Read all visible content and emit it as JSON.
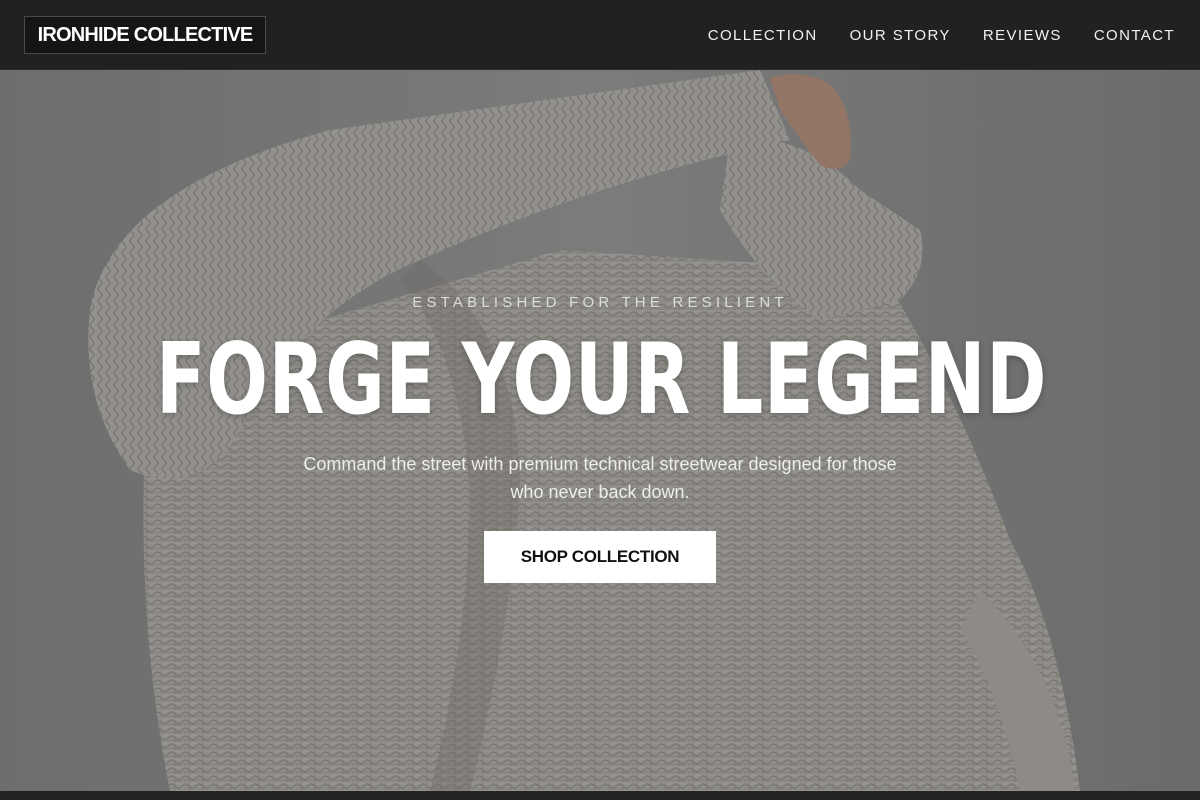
{
  "header": {
    "logo": "IRONHIDE COLLECTIVE",
    "nav": [
      {
        "label": "COLLECTION"
      },
      {
        "label": "OUR STORY"
      },
      {
        "label": "REVIEWS"
      },
      {
        "label": "CONTACT"
      }
    ]
  },
  "hero": {
    "eyebrow": "ESTABLISHED FOR THE RESILIENT",
    "headline": "FORGE YOUR LEGEND",
    "subhead": "Command the street with premium technical streetwear designed for those who never back down.",
    "cta_label": "SHOP COLLECTION",
    "image": "knit-sweater-photo"
  },
  "colors": {
    "header_bg": "#212121",
    "cta_bg": "#ffffff",
    "text_light": "#ffffff"
  }
}
